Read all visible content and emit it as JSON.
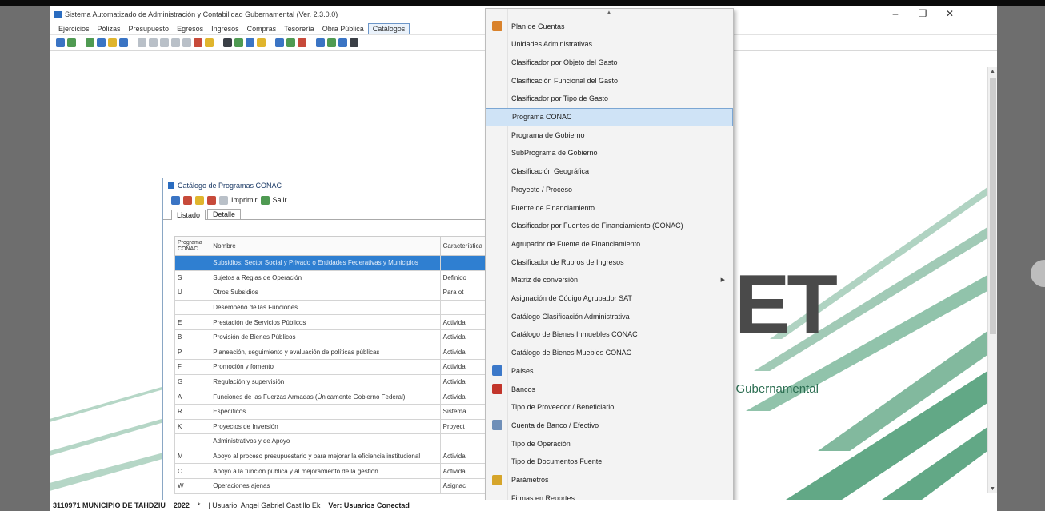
{
  "window": {
    "title": "Sistema Automatizado de Administración y Contabilidad Gubernamental (Ver. 2.3.0.0)",
    "controls": {
      "minimize": "–",
      "restore": "❐",
      "close": "✕"
    }
  },
  "menubar": [
    "Ejercicios",
    "Pólizas",
    "Presupuesto",
    "Egresos",
    "Ingresos",
    "Compras",
    "Tesorería",
    "Obra Pública",
    "Catálogos"
  ],
  "menubar_active_index": 8,
  "background": {
    "logo_text": "ET",
    "logo_subtext": "l Gubernamental"
  },
  "dialog": {
    "title": "Catálogo de Programas CONAC",
    "toolbar": {
      "print_label": "Imprimir",
      "exit_label": "Salir"
    },
    "tabs": [
      "Listado",
      "Detalle"
    ],
    "columns": [
      "Programa CONAC",
      "Nombre",
      "Característica"
    ],
    "rows": [
      {
        "code": "",
        "name": "Subsidios: Sector Social y Privado o Entidades Federativas y Municipios",
        "char": "",
        "selected": true
      },
      {
        "code": "S",
        "name": "Sujetos a Reglas de Operación",
        "char": "Definido"
      },
      {
        "code": "U",
        "name": "Otros Subsidios",
        "char": "Para ot"
      },
      {
        "code": "",
        "name": "Desempeño de las Funciones",
        "char": ""
      },
      {
        "code": "E",
        "name": "Prestación de Servicios Públicos",
        "char": "Activida"
      },
      {
        "code": "B",
        "name": "Provisión de Bienes Públicos",
        "char": "Activida"
      },
      {
        "code": "P",
        "name": "Planeación, seguimiento y evaluación de políticas públicas",
        "char": "Activida"
      },
      {
        "code": "F",
        "name": "Promoción y fomento",
        "char": "Activida"
      },
      {
        "code": "G",
        "name": "Regulación y supervisión",
        "char": "Activida"
      },
      {
        "code": "A",
        "name": "Funciones de las Fuerzas Armadas (Únicamente Gobierno Federal)",
        "char": "Activida"
      },
      {
        "code": "R",
        "name": "Específicos",
        "char": "Sistema"
      },
      {
        "code": "K",
        "name": "Proyectos de Inversión",
        "char": "Proyect"
      },
      {
        "code": "",
        "name": "Administrativos y de Apoyo",
        "char": ""
      },
      {
        "code": "M",
        "name": "Apoyo al proceso presupuestario y para mejorar la eficiencia institucional",
        "char": "Activida"
      },
      {
        "code": "O",
        "name": "Apoyo a la función pública y al mejoramiento de la gestión",
        "char": "Activida"
      },
      {
        "code": "W",
        "name": "Operaciones ajenas",
        "char": "Asignac"
      }
    ]
  },
  "menu": {
    "items": [
      {
        "label": "Plan de Cuentas",
        "icon": "tree-icon",
        "color": "#d9822b"
      },
      {
        "label": "Unidades Administrativas"
      },
      {
        "label": "Clasificador por Objeto del Gasto"
      },
      {
        "label": "Clasificación Funcional del Gasto"
      },
      {
        "label": "Clasificador por Tipo de Gasto"
      },
      {
        "label": "Programa CONAC",
        "highlighted": true
      },
      {
        "label": "Programa de Gobierno"
      },
      {
        "label": "SubPrograma de Gobierno"
      },
      {
        "label": "Clasificación Geográfica"
      },
      {
        "label": "Proyecto / Proceso"
      },
      {
        "label": "Fuente de Financiamiento"
      },
      {
        "label": "Clasificador por Fuentes de Financiamiento (CONAC)"
      },
      {
        "label": "Agrupador de Fuente de Financiamiento"
      },
      {
        "label": "Clasificador de Rubros de Ingresos"
      },
      {
        "label": "Matriz de conversión",
        "submenu": true
      },
      {
        "label": "Asignación de Código Agrupador SAT"
      },
      {
        "label": "Catálogo Clasificación Administrativa"
      },
      {
        "label": "Catálogo de Bienes Inmuebles CONAC"
      },
      {
        "label": "Catálogo de Bienes Muebles CONAC"
      },
      {
        "label": "Países",
        "icon": "globe-icon",
        "color": "#3b78c9"
      },
      {
        "label": "Bancos",
        "icon": "bank-icon",
        "color": "#c2352b"
      },
      {
        "label": "Tipo de Proveedor / Beneficiario"
      },
      {
        "label": "Cuenta de Banco / Efectivo",
        "icon": "account-icon",
        "color": "#6f8fb8"
      },
      {
        "label": "Tipo de Operación"
      },
      {
        "label": "Tipo de Documentos Fuente"
      },
      {
        "label": "Parámetros",
        "icon": "settings-icon",
        "color": "#d6a52a"
      },
      {
        "label": "Firmas en Reportes"
      }
    ],
    "scroll_up": "▲",
    "scroll_down": "▼",
    "submenu_arrow": "▶"
  },
  "status": {
    "entity": "3110971 MUNICIPIO DE TAHDZIU",
    "year": "2022",
    "marker": "*",
    "user": "| Usuario: Angel Gabriel Castillo Ek",
    "connected": "Ver: Usuarios Conectad"
  },
  "colors": {
    "selected_row": "#2f7fd1",
    "menu_highlight": "#cfe3f6",
    "stripe_green": "#2e8b5e"
  }
}
